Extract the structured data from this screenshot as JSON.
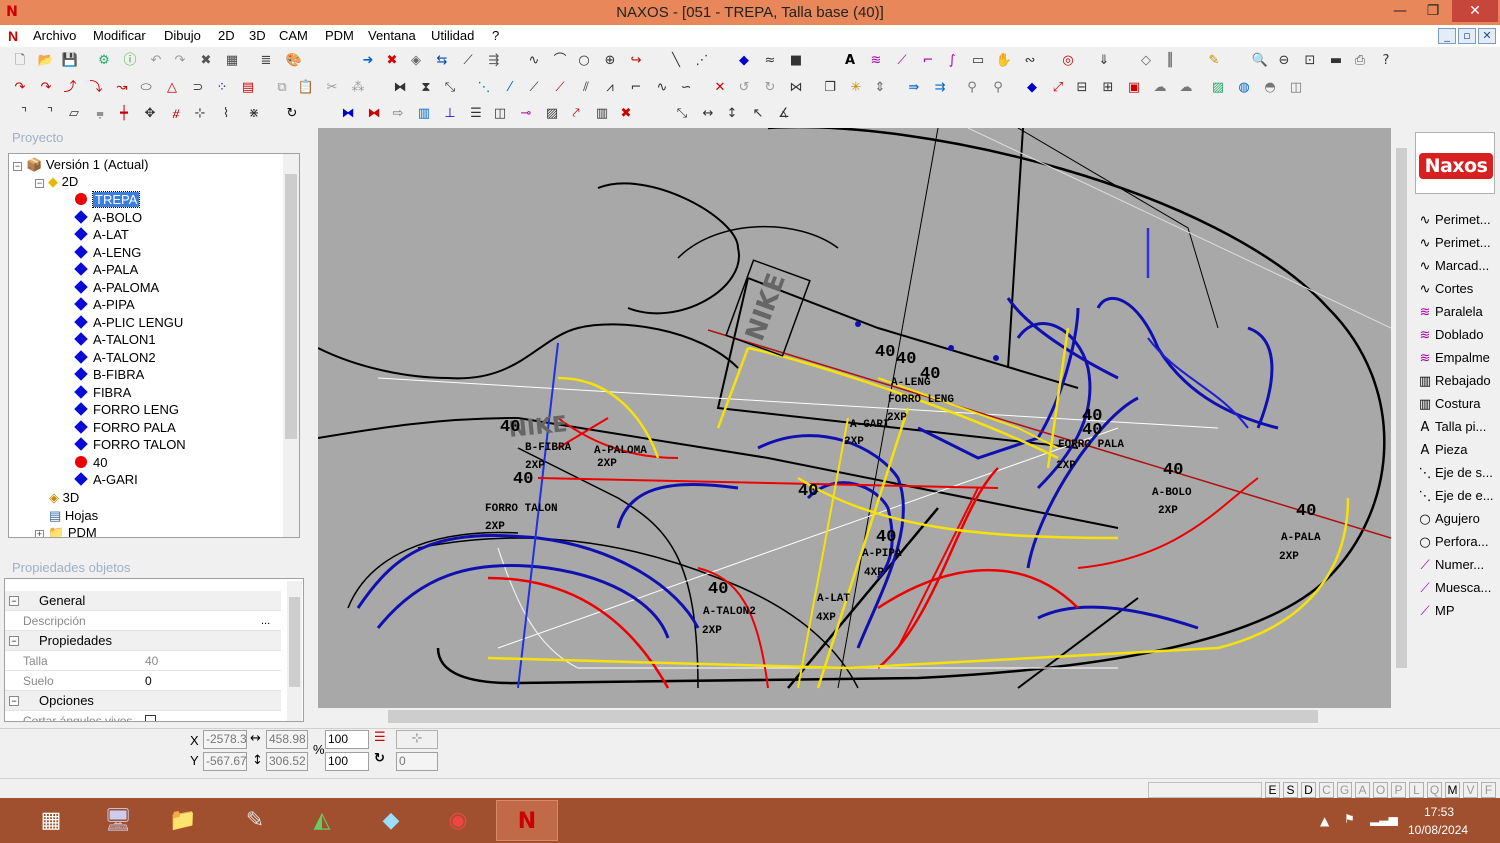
{
  "window": {
    "title": "NAXOS - [051 - TREPA, Talla base (40)]",
    "app_icon": "N",
    "min": "—",
    "max": "❐",
    "close": "✕"
  },
  "menu": {
    "items": [
      "Archivo",
      "Modificar",
      "Dibujo",
      "2D",
      "3D",
      "CAM",
      "PDM",
      "Ventana",
      "Utilidad",
      "?"
    ],
    "mdi": [
      "_",
      "▫",
      "✕"
    ]
  },
  "project": {
    "title": "Proyecto",
    "root": "Versión 1 (Actual)",
    "folder_2d": "2D",
    "pieces": [
      {
        "label": "TREPA",
        "color": "red",
        "selected": true
      },
      {
        "label": "A-BOLO",
        "color": "blue"
      },
      {
        "label": "A-LAT",
        "color": "blue"
      },
      {
        "label": "A-LENG",
        "color": "blue"
      },
      {
        "label": "A-PALA",
        "color": "blue"
      },
      {
        "label": "A-PALOMA",
        "color": "blue"
      },
      {
        "label": "A-PIPA",
        "color": "blue"
      },
      {
        "label": "A-PLIC LENGU",
        "color": "blue"
      },
      {
        "label": "A-TALON1",
        "color": "blue"
      },
      {
        "label": "A-TALON2",
        "color": "blue"
      },
      {
        "label": "B-FIBRA",
        "color": "blue"
      },
      {
        "label": "FIBRA",
        "color": "blue"
      },
      {
        "label": "FORRO LENG",
        "color": "blue"
      },
      {
        "label": "FORRO PALA",
        "color": "blue"
      },
      {
        "label": "FORRO TALON",
        "color": "blue"
      },
      {
        "label": "40",
        "color": "red"
      },
      {
        "label": "A-GARI",
        "color": "blue"
      }
    ],
    "folder_3d": "3D",
    "folder_hojas": "Hojas",
    "folder_pdm": "PDM"
  },
  "properties": {
    "title": "Propiedades objetos",
    "general": "General",
    "descripcion_label": "Descripción",
    "descripcion_btn": "...",
    "propiedades": "Propiedades",
    "talla_label": "Talla",
    "talla_value": "40",
    "suelo_label": "Suelo",
    "suelo_value": "0",
    "opciones": "Opciones",
    "cortar_label": "Cortar ángulos vivos"
  },
  "canvas": {
    "bg_color": "#a8a8a8",
    "labels": [
      {
        "t": "40",
        "big": true
      },
      {
        "t": "40",
        "big": true
      },
      {
        "t": "A-LENG"
      },
      {
        "t": "40",
        "big": true
      },
      {
        "t": "FORRO LENG"
      },
      {
        "t": "2XP"
      },
      {
        "t": "40",
        "big": true
      },
      {
        "t": "40",
        "big": true
      },
      {
        "t": "FORRO PALA"
      },
      {
        "t": "2XP"
      },
      {
        "t": "40",
        "big": true
      },
      {
        "t": "A-BOLO"
      },
      {
        "t": "2XP"
      },
      {
        "t": "40",
        "big": true
      },
      {
        "t": "A-PALA"
      },
      {
        "t": "2XP"
      },
      {
        "t": "A-GARI"
      },
      {
        "t": "2XP"
      },
      {
        "t": "40",
        "big": true
      },
      {
        "t": "40",
        "big": true
      },
      {
        "t": "A-PIPA"
      },
      {
        "t": "4XP"
      },
      {
        "t": "A-LAT"
      },
      {
        "t": "4XP"
      },
      {
        "t": "40",
        "big": true
      },
      {
        "t": "A-TALON2"
      },
      {
        "t": "2XP"
      },
      {
        "t": "40",
        "big": true
      },
      {
        "t": "FORRO TALON"
      },
      {
        "t": "2XP"
      },
      {
        "t": "40",
        "big": true
      },
      {
        "t": "B-FIBRA"
      },
      {
        "t": "2XP"
      },
      {
        "t": "A-PALOMA"
      },
      {
        "t": "2XP"
      }
    ]
  },
  "tools": {
    "items": [
      {
        "icon": "perimeter-icon",
        "label": "Perimet..."
      },
      {
        "icon": "perimeter-icon",
        "label": "Perimet..."
      },
      {
        "icon": "mark-icon",
        "label": "Marcad..."
      },
      {
        "icon": "cut-icon",
        "label": "Cortes"
      },
      {
        "icon": "parallel-icon",
        "label": "Paralela"
      },
      {
        "icon": "fold-icon",
        "label": "Doblado"
      },
      {
        "icon": "joint-icon",
        "label": "Empalme"
      },
      {
        "icon": "skive-icon",
        "label": "Rebajado"
      },
      {
        "icon": "stitch-icon",
        "label": "Costura"
      },
      {
        "icon": "text-icon",
        "label": "Talla pi..."
      },
      {
        "icon": "text-icon",
        "label": "Pieza"
      },
      {
        "icon": "axis-icon",
        "label": "Eje de s..."
      },
      {
        "icon": "axis-icon",
        "label": "Eje de e..."
      },
      {
        "icon": "hole-icon",
        "label": "Agujero"
      },
      {
        "icon": "hole-icon",
        "label": "Perfora..."
      },
      {
        "icon": "number-icon",
        "label": "Numer..."
      },
      {
        "icon": "notch-icon",
        "label": "Muesca..."
      },
      {
        "icon": "mp-icon",
        "label": "MP"
      }
    ],
    "logo": "Naxos"
  },
  "coords": {
    "x_label": "X",
    "y_label": "Y",
    "x_value": "-2578.3",
    "y_value": "-567.67",
    "w_value": "458.98",
    "h_value": "306.52",
    "pct_label": "%",
    "scale_x": "100",
    "scale_y": "100",
    "rot_value": "0"
  },
  "status": {
    "letters": [
      "E",
      "S",
      "D",
      "C",
      "G",
      "A",
      "O",
      "P",
      "L",
      "Q",
      "M",
      "V",
      "F"
    ],
    "on": [
      "E",
      "S",
      "D",
      "M"
    ]
  },
  "taskbar": {
    "time": "17:53",
    "date": "10/08/2024"
  }
}
